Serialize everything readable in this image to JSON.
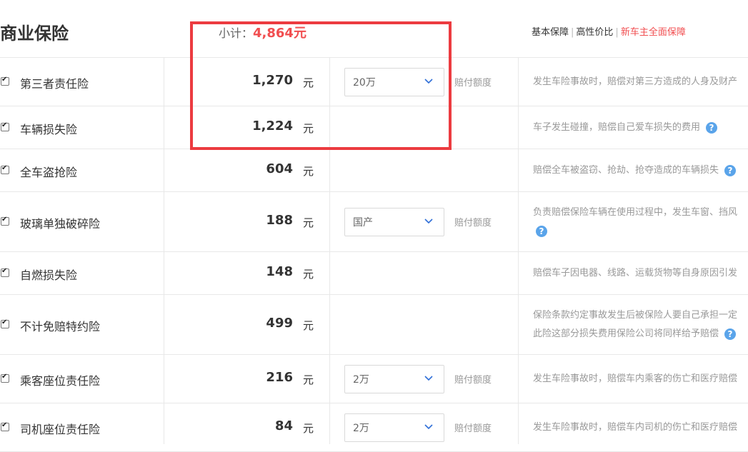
{
  "header": {
    "title": "商业保险",
    "subtotal_label": "小计：",
    "subtotal_amount": "4,864元",
    "tabs": [
      "基本保障",
      "高性价比",
      "新车主全面保障"
    ],
    "active_tab": "新车主全面保障"
  },
  "rows": [
    {
      "name": "第三者责任险",
      "price": "1,270",
      "unit": "元",
      "select": "20万",
      "limit": "赔付额度",
      "desc": [
        "发生车险事故时，赔偿对第三方造成的人身及财产"
      ],
      "checked": true
    },
    {
      "name": "车辆损失险",
      "price": "1,224",
      "unit": "元",
      "select": "",
      "limit": "",
      "desc": [
        "车子发生碰撞，赔偿自己爱车损失的费用"
      ],
      "checked": true
    },
    {
      "name": "全车盗抢险",
      "price": "604",
      "unit": "元",
      "select": "",
      "limit": "",
      "desc": [
        "赔偿全车被盗窃、抢劫、抢夺造成的车辆损失"
      ],
      "checked": true
    },
    {
      "name": "玻璃单独破碎险",
      "price": "188",
      "unit": "元",
      "select": "国产",
      "limit": "赔付额度",
      "desc": [
        "负责赔偿保险车辆在使用过程中，发生车窗、挡风"
      ],
      "checked": true
    },
    {
      "name": "自燃损失险",
      "price": "148",
      "unit": "元",
      "select": "",
      "limit": "",
      "desc": [
        "赔偿车子因电器、线路、运载货物等自身原因引发"
      ],
      "checked": true
    },
    {
      "name": "不计免赔特约险",
      "price": "499",
      "unit": "元",
      "select": "",
      "limit": "",
      "desc": [
        "保险条款约定事故发生后被保险人要自己承担一定",
        "此险这部分损失费用保险公司将同样给予赔偿"
      ],
      "checked": true
    },
    {
      "name": "乘客座位责任险",
      "price": "216",
      "unit": "元",
      "select": "2万",
      "limit": "赔付额度",
      "desc": [
        "发生车险事故时，赔偿车内乘客的伤亡和医疗赔偿"
      ],
      "checked": true
    },
    {
      "name": "司机座位责任险",
      "price": "84",
      "unit": "元",
      "select": "2万",
      "limit": "赔付额度",
      "desc": [
        "发生车险事故时，赔偿车内司机的伤亡和医疗赔偿"
      ],
      "checked": true
    }
  ],
  "help_glyph": "?",
  "colors": {
    "accent_red": "#f14e50",
    "help_blue": "#5aa4ea",
    "highlight_box": "#ec3b40"
  }
}
